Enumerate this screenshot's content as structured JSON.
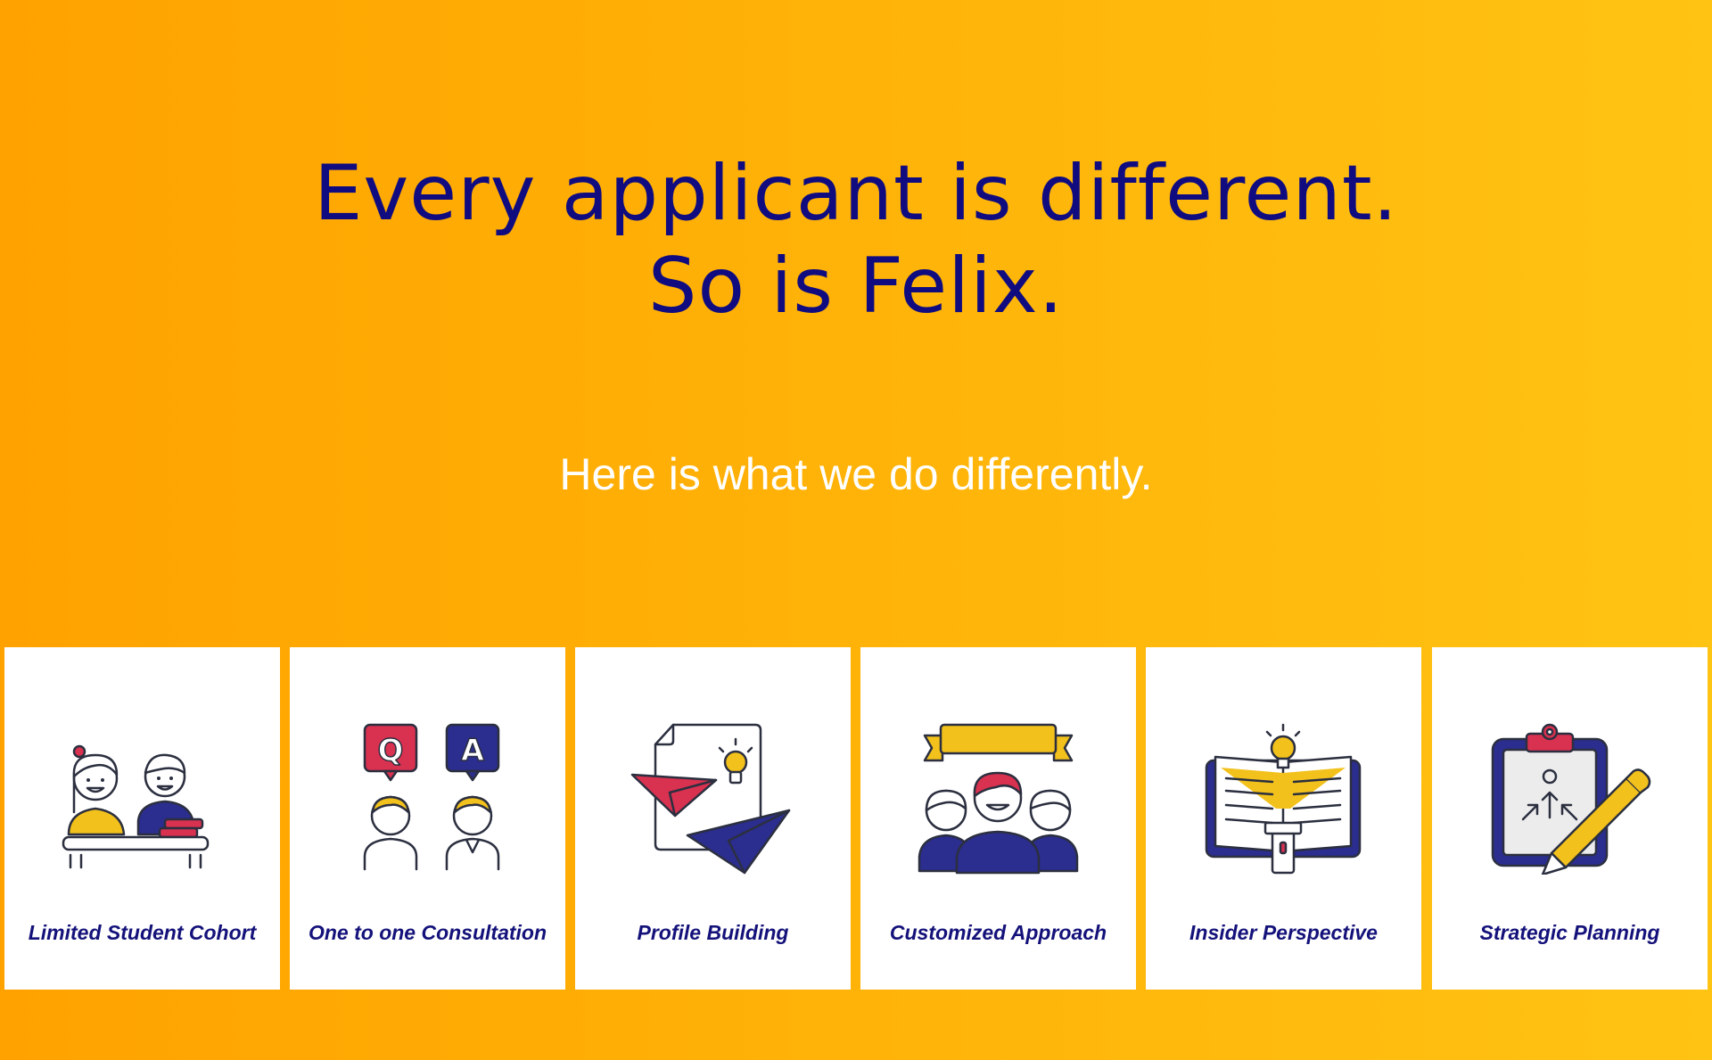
{
  "hero": {
    "headline_line1": "Every applicant is different.",
    "headline_line2": "So is Felix.",
    "subline": "Here is what we do differently."
  },
  "cards": [
    {
      "label": "Limited Student Cohort",
      "icon": "students-at-desk-icon"
    },
    {
      "label": "One to one Consultation",
      "icon": "question-answer-icon"
    },
    {
      "label": "Profile Building",
      "icon": "paper-planes-document-icon"
    },
    {
      "label": "Customized Approach",
      "icon": "team-banner-icon"
    },
    {
      "label": "Insider Perspective",
      "icon": "book-lightbulb-icon"
    },
    {
      "label": "Strategic Planning",
      "icon": "clipboard-pen-icon"
    }
  ],
  "colors": {
    "navy": "#14127A",
    "yellow": "#F2C11C",
    "red": "#D93150",
    "blue": "#2B2D8F",
    "outline": "#2B2F3F"
  }
}
